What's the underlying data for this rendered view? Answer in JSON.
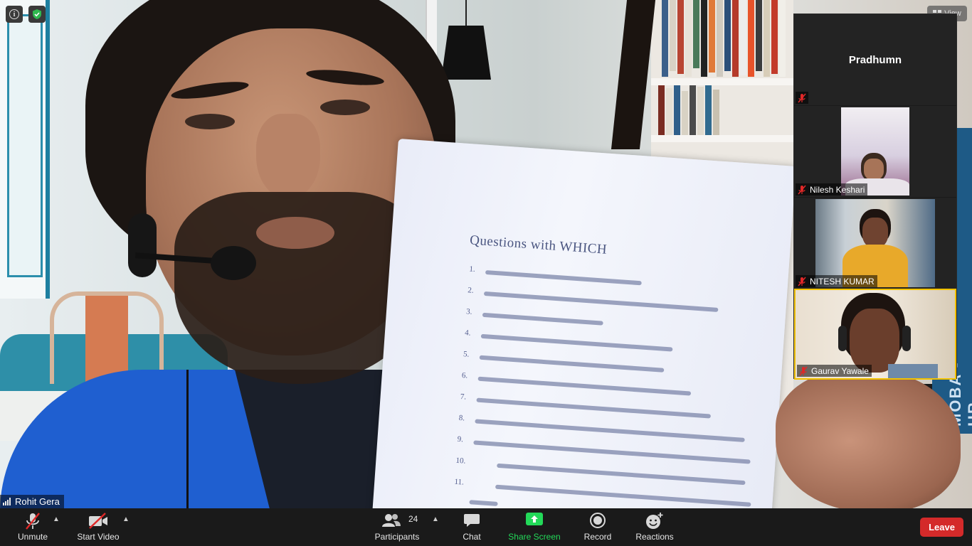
{
  "main_video": {
    "speaker_name": "Rohit Gera",
    "paper_title": "Questions with WHICH",
    "book_spine_text": "MOBA - HR KALIKA"
  },
  "top_bar": {
    "info_icon": "info-icon",
    "security_icon": "shield-check-icon",
    "view_label": "View"
  },
  "participants_panel": {
    "tiles": [
      {
        "name": "Pradhumn",
        "muted": true,
        "video": false
      },
      {
        "name": "Nilesh Keshari",
        "muted": true,
        "video": true
      },
      {
        "name": "NITESH KUMAR",
        "muted": true,
        "video": true
      },
      {
        "name": "Gaurav Yawale",
        "muted": true,
        "video": true
      }
    ]
  },
  "toolbar": {
    "unmute_label": "Unmute",
    "start_video_label": "Start Video",
    "participants_label": "Participants",
    "participants_count": "24",
    "chat_label": "Chat",
    "share_screen_label": "Share Screen",
    "record_label": "Record",
    "reactions_label": "Reactions",
    "leave_label": "Leave"
  },
  "colors": {
    "toolbar_bg": "#1a1a1a",
    "share_green": "#23d959",
    "leave_red": "#d42a2a",
    "mute_red": "#e02828"
  }
}
